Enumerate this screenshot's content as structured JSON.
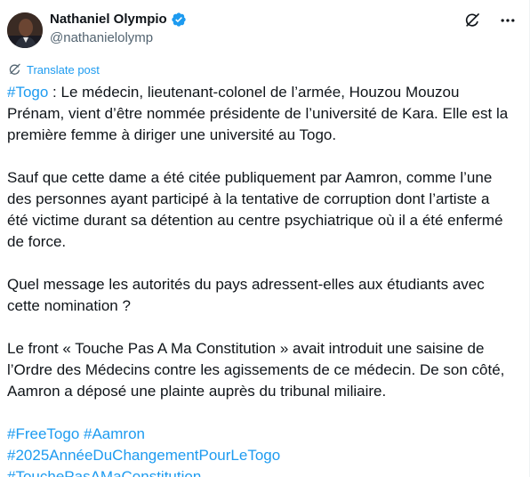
{
  "author": {
    "name": "Nathaniel Olympio",
    "handle": "@nathanielolymp",
    "verified": true,
    "avatar_icon": "user-avatar"
  },
  "actions": {
    "grok_icon": "grok-icon",
    "more_icon": "more-options-icon"
  },
  "translate": {
    "label": "Translate post",
    "icon": "translate-icon"
  },
  "post": {
    "p1_tag": "#Togo",
    "p1_text": " : Le médecin, lieutenant-colonel de l’armée, Houzou Mouzou Prénam, vient d’être nommée présidente de l’université de Kara. Elle est la première femme à diriger une université au Togo.",
    "p2": "Sauf que cette dame a été citée publiquement par Aamron, comme l’une des personnes ayant participé à la tentative de corruption dont l’artiste a été victime durant sa détention au centre psychiatrique où il a été enfermé de force.",
    "p3": "Quel message les autorités du pays adressent-elles aux étudiants avec cette nomination ?",
    "p4": "Le front « Touche Pas A Ma Constitution » avait introduit une saisine de l’Ordre des Médecins contre les agissements de ce médecin. De son côté, Aamron a déposé une plainte auprès du tribunal miliaire.",
    "hashtags": [
      "#FreeTogo",
      "#Aamron",
      "#2025AnnéeDuChangementPourLeTogo",
      "#TouchePasAMaConstitution"
    ]
  },
  "colors": {
    "link": "#1d9bf0",
    "text": "#0f1419",
    "secondary": "#536471"
  }
}
